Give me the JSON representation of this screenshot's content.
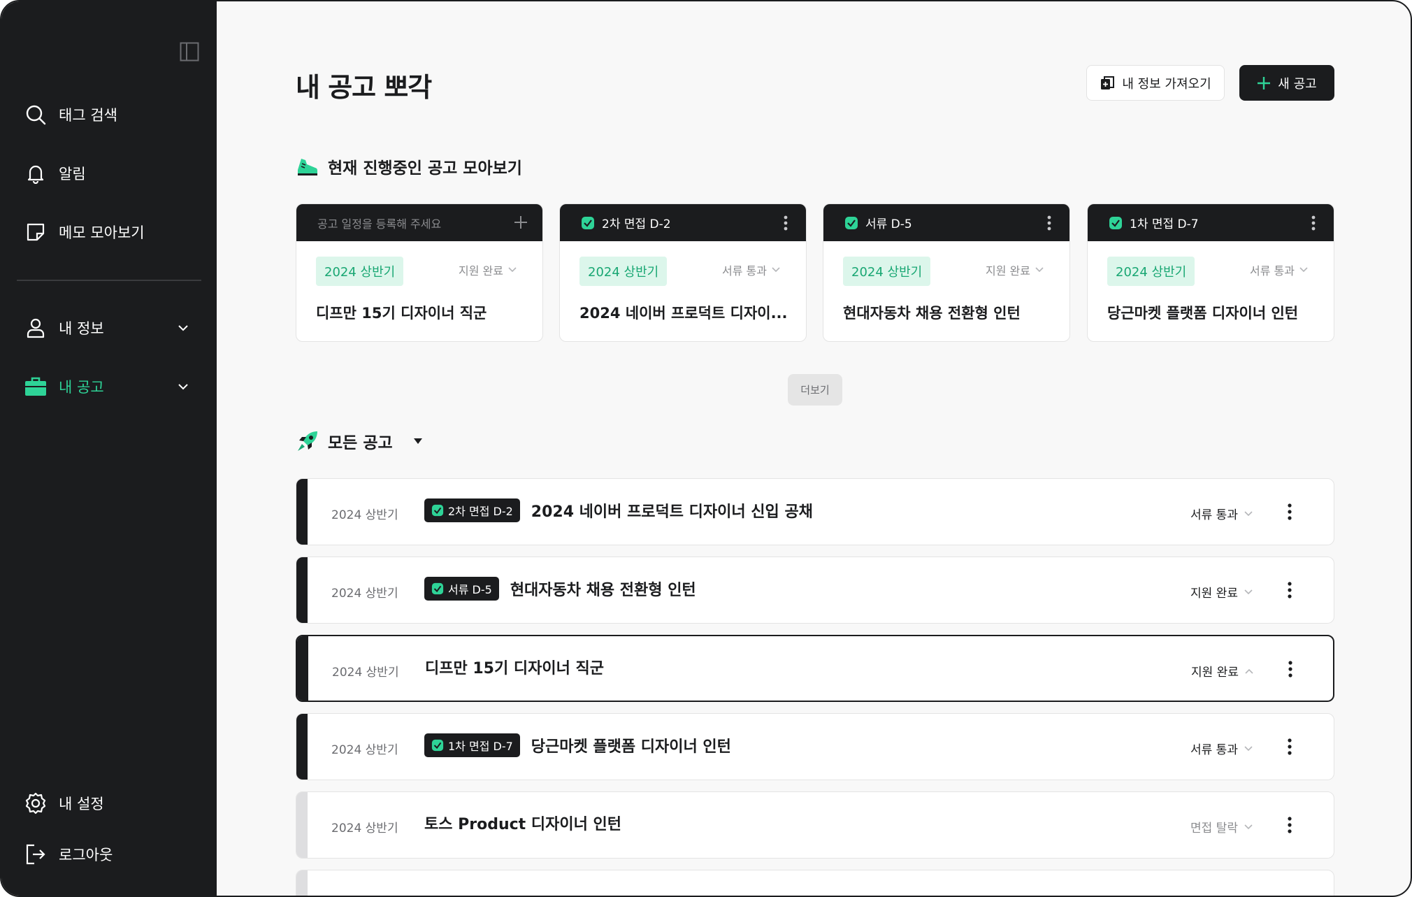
{
  "sidebar": {
    "items": [
      {
        "label": "태그 검색",
        "icon": "search-icon"
      },
      {
        "label": "알림",
        "icon": "bell-icon"
      },
      {
        "label": "메모 모아보기",
        "icon": "memo-icon"
      },
      {
        "label": "내 정보",
        "icon": "user-icon"
      },
      {
        "label": "내 공고",
        "icon": "briefcase-icon"
      }
    ],
    "bottom": [
      {
        "label": "내 설정",
        "icon": "gear-icon"
      },
      {
        "label": "로그아웃",
        "icon": "logout-icon"
      }
    ]
  },
  "header": {
    "title": "내 공고 뽀각",
    "import_label": "내 정보 가져오기",
    "new_label": "새 공고"
  },
  "ongoing": {
    "title": "현재 진행중인 공고 모아보기",
    "placeholder": "공고 일정을 등록해 주세요",
    "cards": [
      {
        "header": "",
        "period": "2024 상반기",
        "status": "지원 완료",
        "name": "디프만 15기 디자이너 직군"
      },
      {
        "header": "2차 면접 D-2",
        "period": "2024 상반기",
        "status": "서류 통과",
        "name": "2024 네이버 프로덕트 디자이..."
      },
      {
        "header": "서류 D-5",
        "period": "2024 상반기",
        "status": "지원 완료",
        "name": "현대자동차 채용 전환형 인턴"
      },
      {
        "header": "1차 면접 D-7",
        "period": "2024 상반기",
        "status": "서류 통과",
        "name": "당근마켓 플랫폼 디자이너 인턴"
      }
    ],
    "more_label": "더보기"
  },
  "all": {
    "title": "모든 공고",
    "rows": [
      {
        "period": "2024 상반기",
        "badge": "2차 면접 D-2",
        "title": "2024 네이버 프로덕트 디자이너 신입 공채",
        "status": "서류 통과"
      },
      {
        "period": "2024 상반기",
        "badge": "서류 D-5",
        "title": "현대자동차 채용 전환형 인턴",
        "status": "지원 완료"
      },
      {
        "period": "2024 상반기",
        "badge": "",
        "title": "디프만 15기 디자이너 직군",
        "status": "지원 완료"
      },
      {
        "period": "2024 상반기",
        "badge": "1차 면접 D-7",
        "title": "당근마켓 플랫폼 디자이너 인턴",
        "status": "서류 통과"
      },
      {
        "period": "2024 상반기",
        "badge": "",
        "title": "토스 Product 디자이너 인턴",
        "status": "면접 탈락"
      }
    ]
  },
  "colors": {
    "accent": "#2ed397",
    "dark": "#1b1c1e",
    "chip_bg": "#dcf6eb",
    "chip_text": "#19a773"
  }
}
